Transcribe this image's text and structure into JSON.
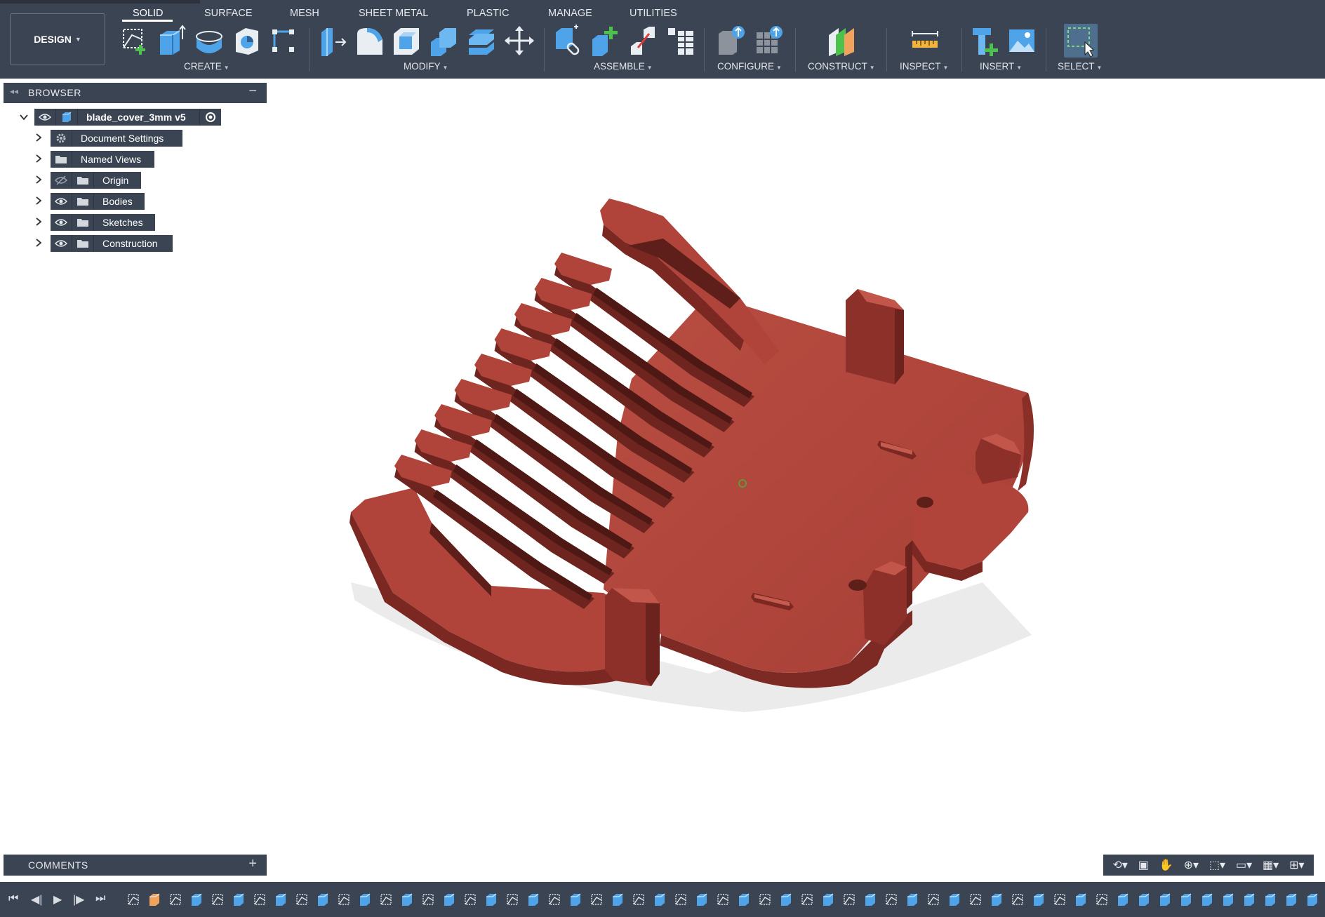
{
  "toolbar": {
    "workspace_label": "DESIGN",
    "tabs": [
      "SOLID",
      "SURFACE",
      "MESH",
      "SHEET METAL",
      "PLASTIC",
      "MANAGE",
      "UTILITIES"
    ],
    "active_tab": "SOLID",
    "groups": [
      "CREATE",
      "MODIFY",
      "ASSEMBLE",
      "CONFIGURE",
      "CONSTRUCT",
      "INSPECT",
      "INSERT",
      "SELECT"
    ],
    "colors": {
      "bar": "#3b4453",
      "icon_blue": "#4fa3e8",
      "icon_green": "#4cc24c"
    }
  },
  "browser": {
    "title": "BROWSER",
    "root": {
      "label": "blade_cover_3mm v5",
      "icon": "component-icon"
    },
    "items": [
      {
        "label": "Document Settings",
        "icon": "gear-icon",
        "visibility": "none"
      },
      {
        "label": "Named Views",
        "icon": "folder-icon",
        "visibility": "none"
      },
      {
        "label": "Origin",
        "icon": "folder-icon",
        "visibility": "hidden"
      },
      {
        "label": "Bodies",
        "icon": "folder-icon",
        "visibility": "visible"
      },
      {
        "label": "Sketches",
        "icon": "folder-icon",
        "visibility": "visible"
      },
      {
        "label": "Construction",
        "icon": "folder-icon",
        "visibility": "visible"
      }
    ]
  },
  "comments": {
    "title": "COMMENTS"
  },
  "model": {
    "color": "#b0443a",
    "shadow": "#dcdcdc"
  },
  "navbar_icons": [
    "orbit-icon",
    "look-at-icon",
    "pan-icon",
    "zoom-icon",
    "fit-icon",
    "display-settings-icon",
    "grid-icon",
    "viewports-icon"
  ],
  "timeline": {
    "controls": [
      "go-to-start",
      "step-back",
      "play",
      "step-forward",
      "go-to-end"
    ],
    "feature_count": 57
  }
}
